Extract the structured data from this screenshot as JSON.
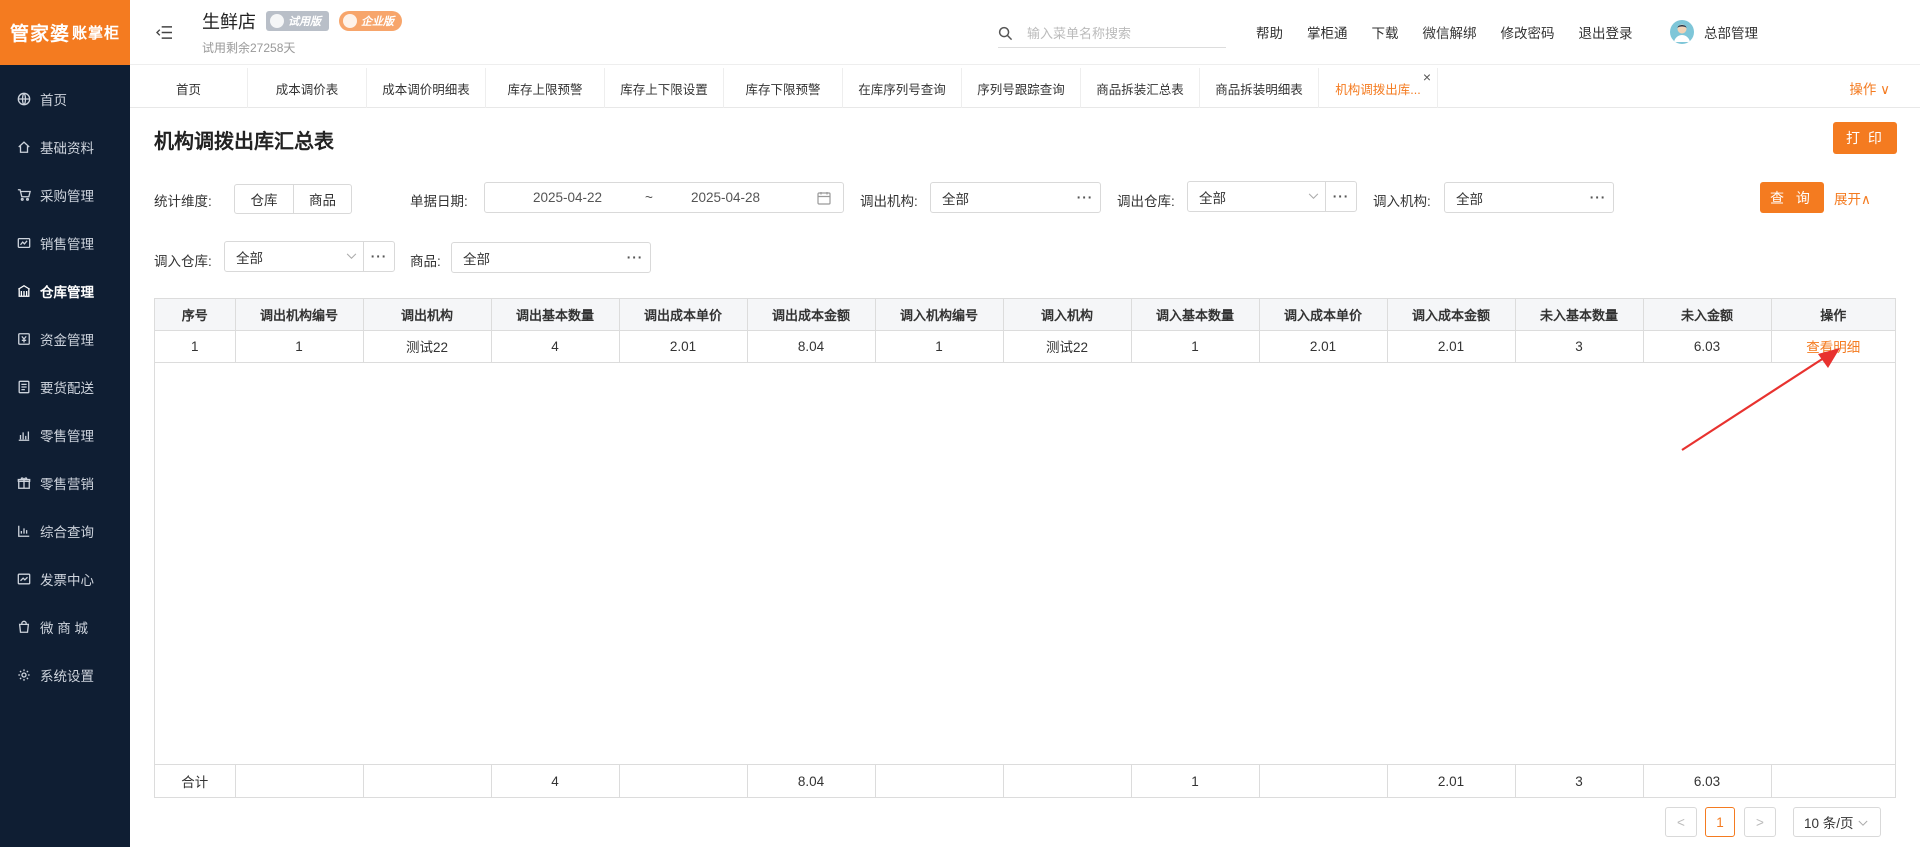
{
  "brand": {
    "logo_main": "管家婆",
    "logo_sub": "账掌柜"
  },
  "sidebar": {
    "items": [
      {
        "label": "首页",
        "icon": "globe-icon"
      },
      {
        "label": "基础资料",
        "icon": "home-icon"
      },
      {
        "label": "采购管理",
        "icon": "cart-icon"
      },
      {
        "label": "销售管理",
        "icon": "sales-icon"
      },
      {
        "label": "仓库管理",
        "icon": "warehouse-icon"
      },
      {
        "label": "资金管理",
        "icon": "money-icon"
      },
      {
        "label": "要货配送",
        "icon": "delivery-icon"
      },
      {
        "label": "零售管理",
        "icon": "retail-icon"
      },
      {
        "label": "零售营销",
        "icon": "gift-icon"
      },
      {
        "label": "综合查询",
        "icon": "chart-icon"
      },
      {
        "label": "发票中心",
        "icon": "invoice-icon"
      },
      {
        "label": "微 商 城",
        "icon": "bag-icon"
      },
      {
        "label": "系统设置",
        "icon": "gear-icon"
      }
    ]
  },
  "header": {
    "store_name": "生鲜店",
    "badge_trial": "试用版",
    "badge_enterprise": "企业版",
    "trial_remaining": "试用剩余27258天",
    "search_placeholder": "输入菜单名称搜索",
    "links": [
      "帮助",
      "掌柜通",
      "下载",
      "微信解绑",
      "修改密码",
      "退出登录"
    ],
    "user_name": "总部管理"
  },
  "tabs": [
    "首页",
    "成本调价表",
    "成本调价明细表",
    "库存上限预警",
    "库存上下限设置",
    "库存下限预警",
    "在库序列号查询",
    "序列号跟踪查询",
    "商品拆装汇总表",
    "商品拆装明细表",
    "机构调拨出库..."
  ],
  "tabs_ops": "操作 ∨",
  "page": {
    "title": "机构调拨出库汇总表",
    "print_label": "打 印",
    "filters": {
      "dimension_label": "统计维度:",
      "dimension_options": [
        "仓库",
        "商品"
      ],
      "date_label": "单据日期:",
      "date_start": "2025-04-22",
      "date_sep": "~",
      "date_end": "2025-04-28",
      "out_org_label": "调出机构:",
      "out_org_value": "全部",
      "out_wh_label": "调出仓库:",
      "out_wh_value": "全部",
      "in_org_label": "调入机构:",
      "in_org_value": "全部",
      "in_wh_label": "调入仓库:",
      "in_wh_value": "全部",
      "product_label": "商品:",
      "product_value": "全部",
      "query_label": "查 询",
      "expand_label": "展开∧"
    }
  },
  "table": {
    "columns": [
      "序号",
      "调出机构编号",
      "调出机构",
      "调出基本数量",
      "调出成本单价",
      "调出成本金额",
      "调入机构编号",
      "调入机构",
      "调入基本数量",
      "调入成本单价",
      "调入成本金额",
      "未入基本数量",
      "未入金额",
      "操作"
    ],
    "rows": [
      [
        "1",
        "1",
        "测试22",
        "4",
        "2.01",
        "8.04",
        "1",
        "测试22",
        "1",
        "2.01",
        "2.01",
        "3",
        "6.03",
        "查看明细"
      ]
    ],
    "summary": [
      "合计",
      "",
      "",
      "4",
      "",
      "8.04",
      "",
      "",
      "1",
      "",
      "2.01",
      "3",
      "6.03",
      ""
    ]
  },
  "pagination": {
    "prev": "<",
    "current": "1",
    "next": ">",
    "page_size": "10 条/页"
  },
  "colors": {
    "accent": "#f47b20",
    "sidebar_bg": "#0f1e33",
    "annotation_arrow": "#e8322f"
  }
}
